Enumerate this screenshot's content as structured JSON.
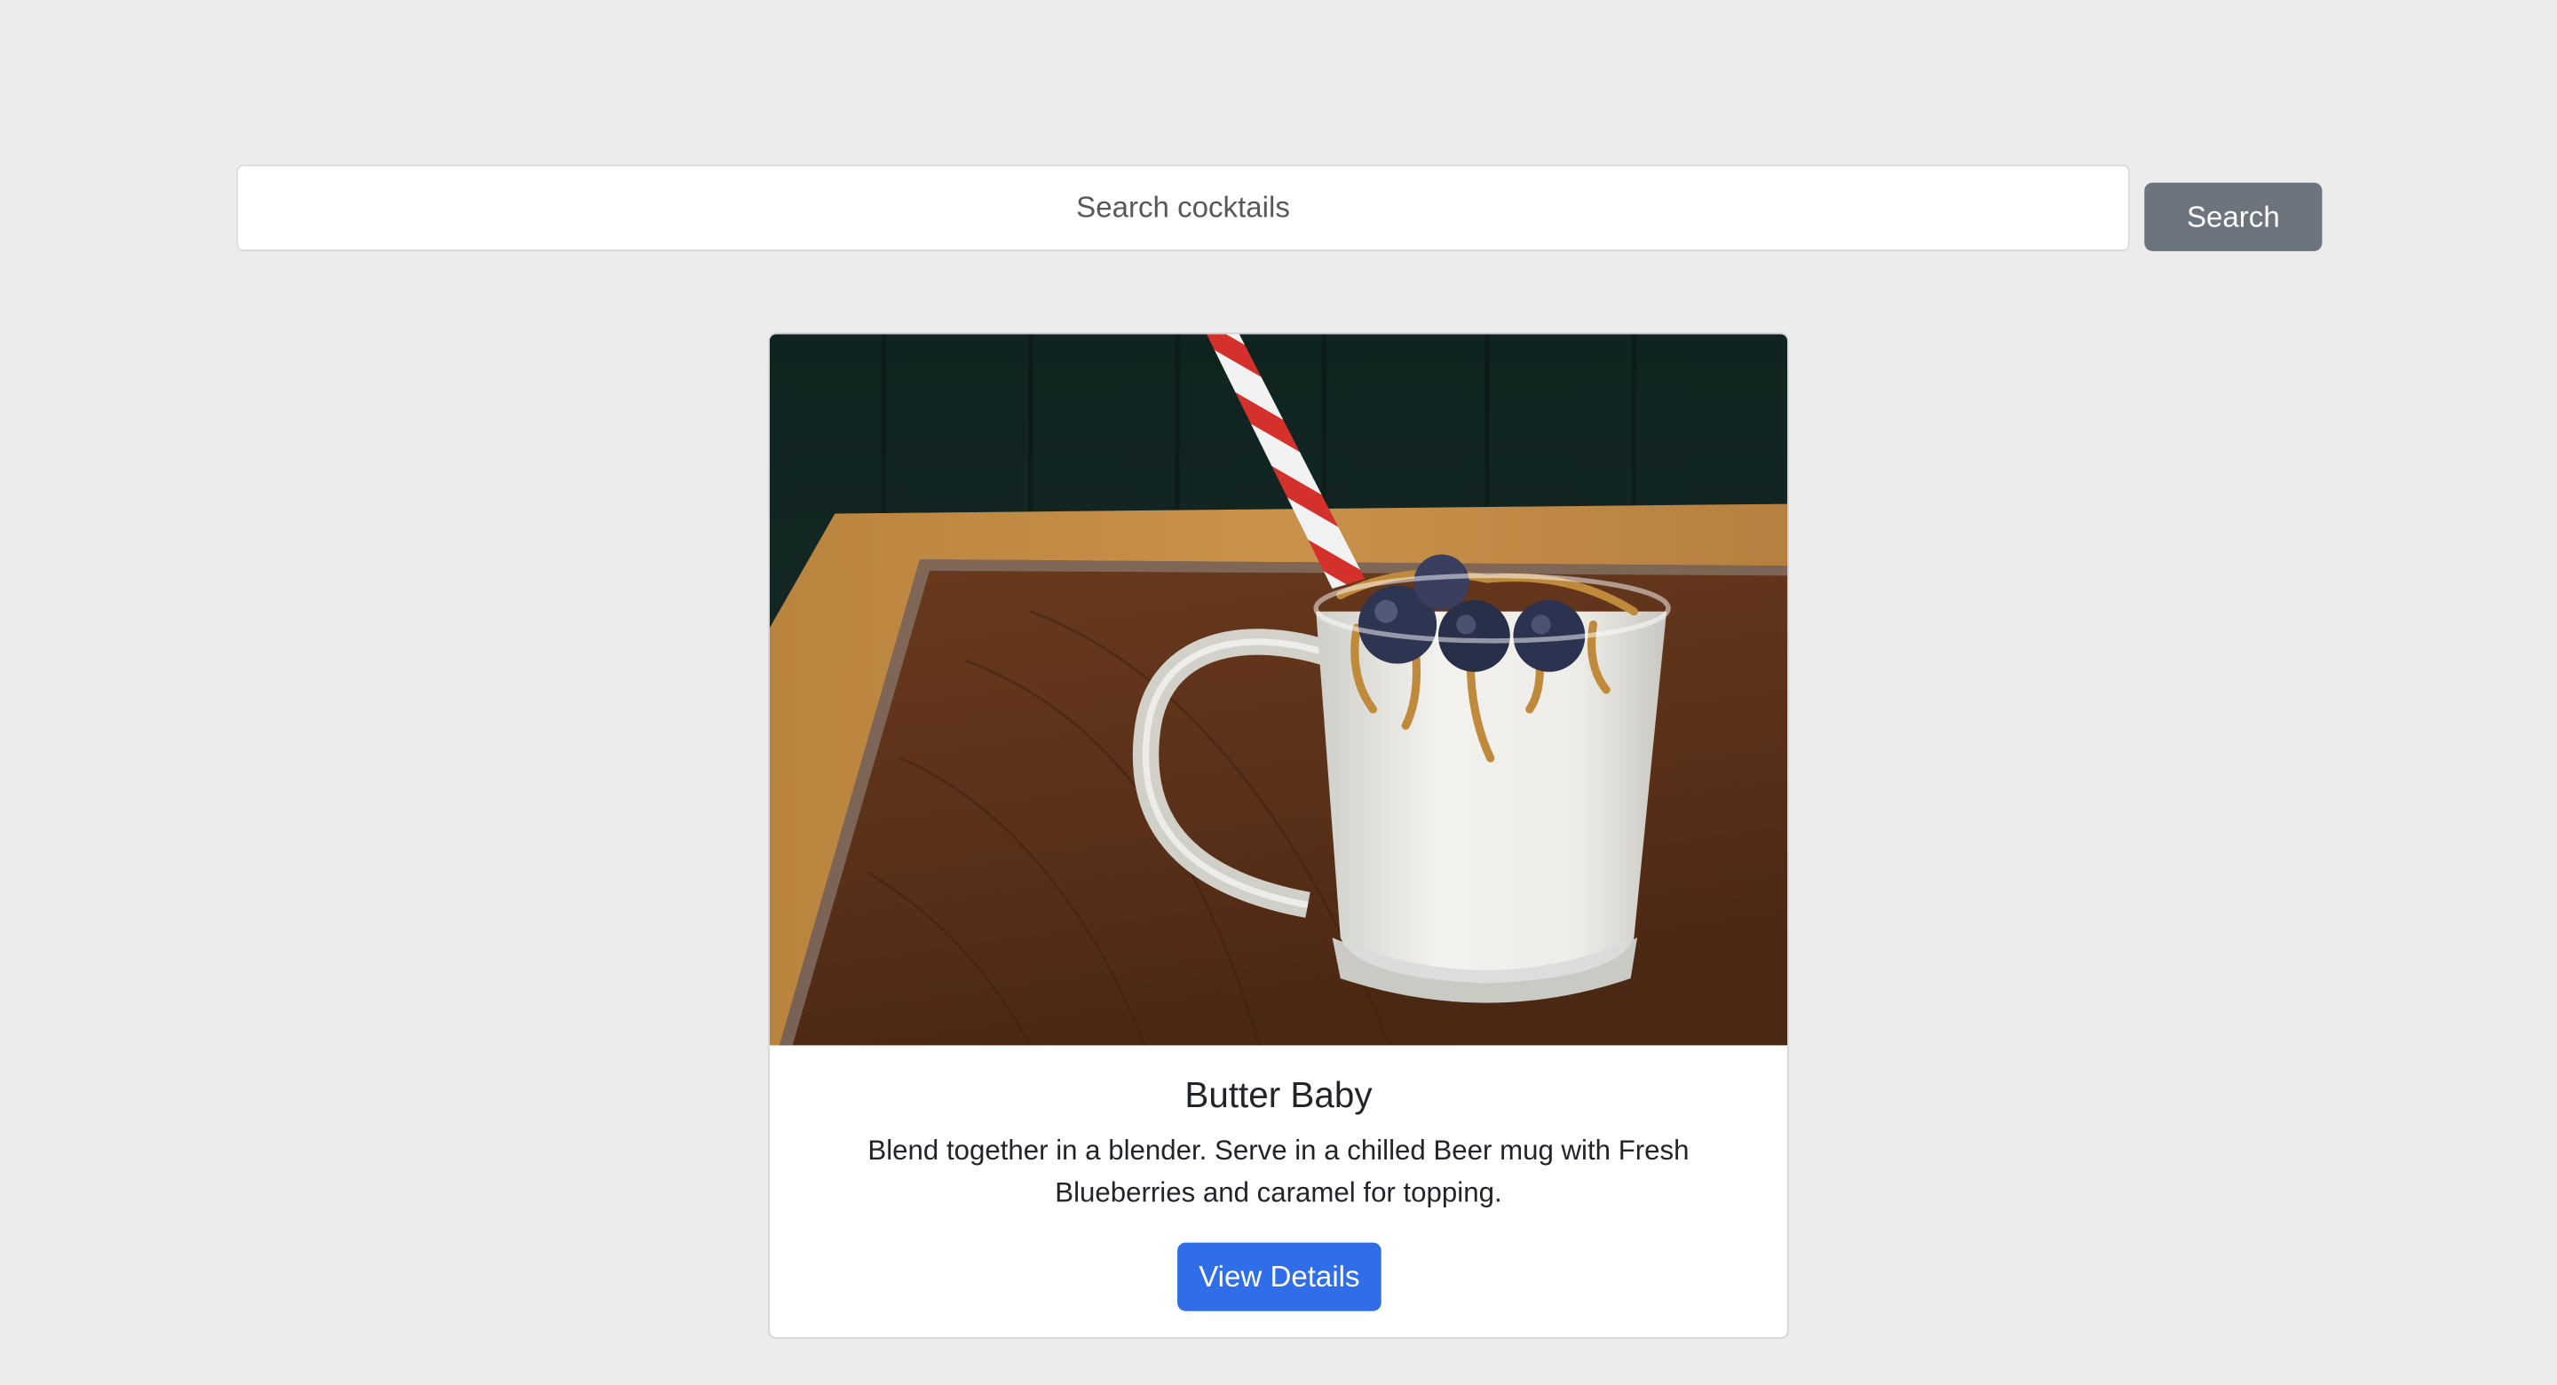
{
  "search": {
    "placeholder": "Search cocktails",
    "value": "",
    "button_label": "Search"
  },
  "card": {
    "image_alt": "Butter Baby",
    "title": "Butter Baby",
    "description": "Blend together in a blender. Serve in a chilled Beer mug with Fresh Blueberries and caramel for topping.",
    "button_label": "View Details"
  },
  "colors": {
    "background": "#ececec",
    "search_button": "#6c757d",
    "primary_button": "#2f6ee8",
    "card_background": "#ffffff"
  }
}
